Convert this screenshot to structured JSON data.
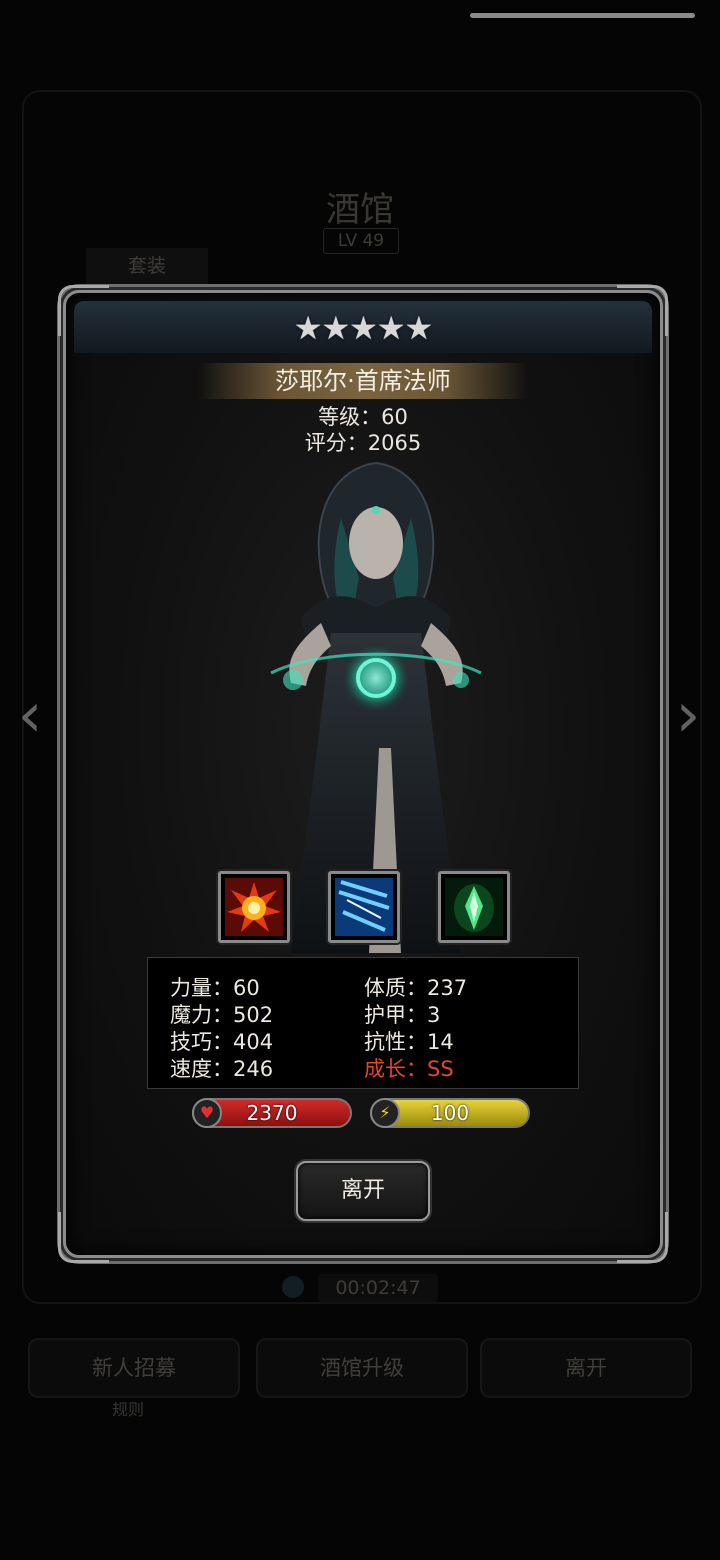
{
  "background": {
    "title": "酒馆",
    "level": "LV 49",
    "tab": "套装",
    "timer": "00:02:47",
    "buttons": [
      "新人招募",
      "酒馆升级",
      "离开"
    ],
    "small_label": "规则"
  },
  "hero": {
    "stars": "★★★★★",
    "name": "莎耶尔·首席法师",
    "level_text": "等级：60",
    "score_text": "评分：2065"
  },
  "skills": [
    {
      "icon": "fire-burst-icon"
    },
    {
      "icon": "lightning-icon"
    },
    {
      "icon": "green-crystal-icon"
    }
  ],
  "stats": {
    "strength": "力量：60",
    "magic": "魔力：502",
    "skill": "技巧：404",
    "speed": "速度：246",
    "constitution": "体质：237",
    "armor": "护甲：3",
    "resistance": "抗性：14",
    "growth": "成长：SS"
  },
  "bars": {
    "hp": "2370",
    "energy": "100"
  },
  "actions": {
    "leave": "离开"
  },
  "colors": {
    "growth_text": "#e2482a",
    "hp_bar": "#c41e1e",
    "energy_bar": "#d9c423"
  }
}
